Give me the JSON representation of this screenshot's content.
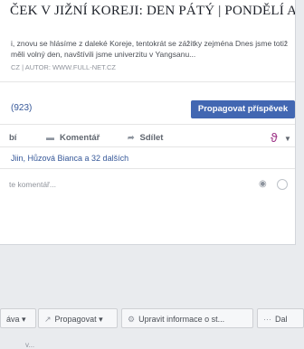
{
  "post": {
    "title": "ČEK V JIŽNÍ KOREJI: DEN PÁTÝ | PONDĚLÍ A",
    "description": "i, znovu se hlásíme z daleké Koreje, tentokrát se zážitky zejména Dnes jsme totiž měli volný den, navštívili jsme univerzitu v Yangsanu...",
    "source": "CZ | AUTOR: WWW.FULL-NET.CZ"
  },
  "stats": {
    "count": "(923)",
    "promote_label": "Propagovat příspěvek"
  },
  "actions": {
    "like": "bí",
    "comment": "Komentář",
    "share": "Sdílet"
  },
  "reactions": {
    "text": "Jiin, Hůzová Bianca a 32 dalších"
  },
  "comment": {
    "placeholder": "te komentář..."
  },
  "toolbar": {
    "item1": "áva",
    "item2": "Propagovat",
    "item3": "Upravit informace o st...",
    "item4": "Dal"
  },
  "bottom": {
    "text": "v..."
  }
}
